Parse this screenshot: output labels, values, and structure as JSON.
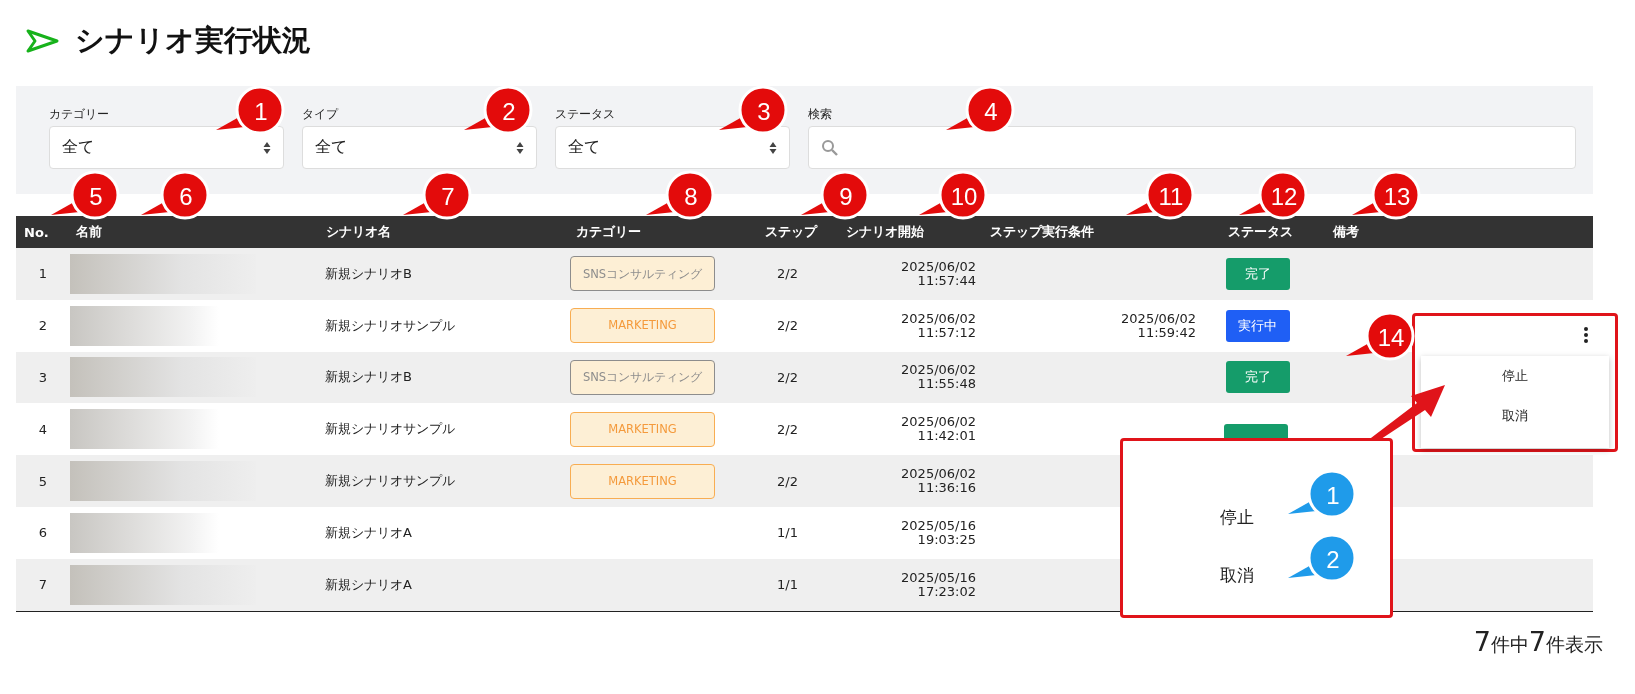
{
  "page_title": "シナリオ実行状況",
  "filters": [
    {
      "label": "カテゴリー",
      "kind": "select",
      "value": "全て"
    },
    {
      "label": "タイプ",
      "kind": "select",
      "value": "全て"
    },
    {
      "label": "ステータス",
      "kind": "select",
      "value": "全て"
    },
    {
      "label": "検索",
      "kind": "search"
    }
  ],
  "table": {
    "columns": [
      "No.",
      "名前",
      "シナリオ名",
      "カテゴリー",
      "ステップ",
      "シナリオ開始",
      "ステップ実行条件",
      "ステータス",
      "備考"
    ],
    "rows": [
      {
        "no": "1",
        "scenario": "新規シナリオB",
        "category": {
          "text": "SNSコンサルティング",
          "kind": "sns"
        },
        "step": "2/2",
        "start": {
          "date": "2025/06/02",
          "time": "11:57:44"
        },
        "status": {
          "text": "完了",
          "kind": "done"
        }
      },
      {
        "no": "2",
        "scenario": "新規シナリオサンプル",
        "category": {
          "text": "MARKETING",
          "kind": "marketing"
        },
        "step": "2/2",
        "start": {
          "date": "2025/06/02",
          "time": "11:57:12"
        },
        "condition": {
          "date": "2025/06/02",
          "time": "11:59:42"
        },
        "status": {
          "text": "実行中",
          "kind": "running"
        }
      },
      {
        "no": "3",
        "scenario": "新規シナリオB",
        "category": {
          "text": "SNSコンサルティング",
          "kind": "sns"
        },
        "step": "2/2",
        "start": {
          "date": "2025/06/02",
          "time": "11:55:48"
        },
        "status": {
          "text": "完了",
          "kind": "done"
        }
      },
      {
        "no": "4",
        "scenario": "新規シナリオサンプル",
        "category": {
          "text": "MARKETING",
          "kind": "marketing"
        },
        "step": "2/2",
        "start": {
          "date": "2025/06/02",
          "time": "11:42:01"
        }
      },
      {
        "no": "5",
        "scenario": "新規シナリオサンプル",
        "category": {
          "text": "MARKETING",
          "kind": "marketing"
        },
        "step": "2/2",
        "start": {
          "date": "2025/06/02",
          "time": "11:36:16"
        }
      },
      {
        "no": "6",
        "scenario": "新規シナリオA",
        "step": "1/1",
        "start": {
          "date": "2025/05/16",
          "time": "19:03:25"
        }
      },
      {
        "no": "7",
        "scenario": "新規シナリオA",
        "step": "1/1",
        "start": {
          "date": "2025/05/16",
          "time": "17:23:02"
        }
      }
    ]
  },
  "footer": [
    {
      "text": "7",
      "kind": "number"
    },
    {
      "text": "件中",
      "kind": "unit"
    },
    {
      "text": "7",
      "kind": "number"
    },
    {
      "text": "件表示",
      "kind": "unit"
    }
  ],
  "row_menu": {
    "items": [
      "停止",
      "取消"
    ]
  },
  "zoom_menu": {
    "items": [
      "停止",
      "取消"
    ]
  },
  "callouts": [
    {
      "label": "1",
      "color": "#e30b0b"
    },
    {
      "label": "2",
      "color": "#e30b0b"
    },
    {
      "label": "3",
      "color": "#e30b0b"
    },
    {
      "label": "4",
      "color": "#e30b0b"
    },
    {
      "label": "5",
      "color": "#e30b0b"
    },
    {
      "label": "6",
      "color": "#e30b0b"
    },
    {
      "label": "7",
      "color": "#e30b0b"
    },
    {
      "label": "8",
      "color": "#e30b0b"
    },
    {
      "label": "9",
      "color": "#e30b0b"
    },
    {
      "label": "10",
      "color": "#e30b0b"
    },
    {
      "label": "11",
      "color": "#e30b0b"
    },
    {
      "label": "12",
      "color": "#e30b0b"
    },
    {
      "label": "13",
      "color": "#e30b0b"
    },
    {
      "label": "14",
      "color": "#e30b0b"
    },
    {
      "label": "1",
      "color": "#1f9bea"
    },
    {
      "label": "2",
      "color": "#1f9bea"
    }
  ]
}
